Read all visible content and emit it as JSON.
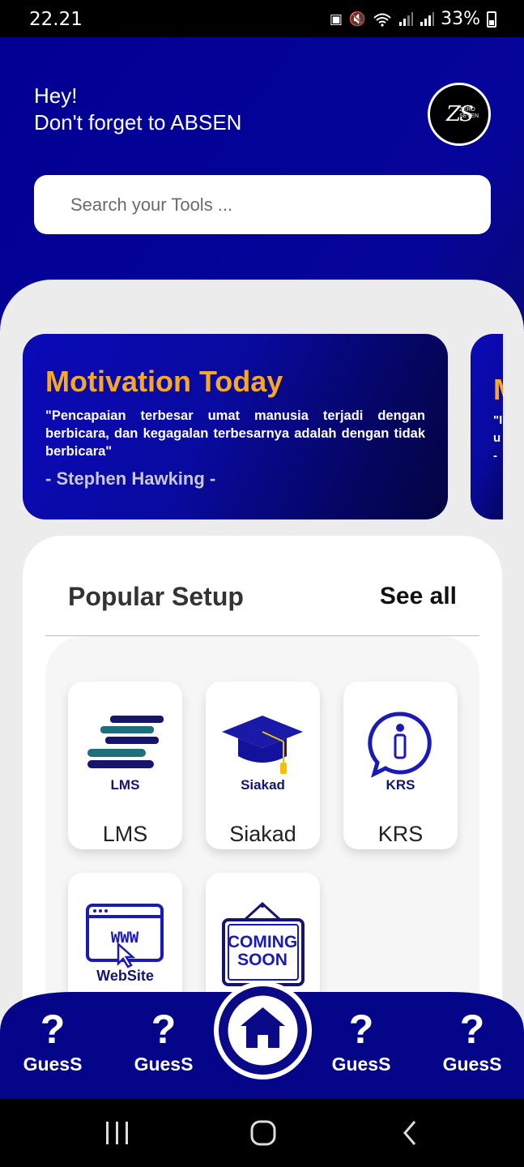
{
  "status_bar": {
    "time": "22.21",
    "battery": "33%",
    "icons": [
      "cast-icon",
      "mute-icon",
      "wifi-icon",
      "signal-icon",
      "signal-icon",
      "battery-icon"
    ]
  },
  "header": {
    "line1": "Hey!",
    "line2": "Don't forget to ABSEN",
    "avatar_text": "ZS",
    "avatar_sub1": "ZERO",
    "avatar_sub2": "SEVEN"
  },
  "search": {
    "placeholder": "Search your Tools ..."
  },
  "motivation": {
    "title": "Motivation Today",
    "quote": "\"Pencapaian terbesar umat manusia terjadi dengan berbicara, dan kegagalan terbesarnya adalah dengan tidak berbicara\"",
    "author": "- Stephen Hawking -",
    "next_peek": {
      "title": "M",
      "text_line1": "\"I",
      "text_line2": "u",
      "author": "-"
    }
  },
  "popular": {
    "title": "Popular Setup",
    "see_all": "See all",
    "tools": [
      {
        "label": "LMS",
        "icon_text": "LMS",
        "icon": "books-icon"
      },
      {
        "label": "Siakad",
        "icon_text": "Siakad",
        "icon": "graduation-cap-icon"
      },
      {
        "label": "KRS",
        "icon_text": "KRS",
        "icon": "info-bubble-icon"
      },
      {
        "label": "",
        "icon_text": "WebSite",
        "icon_browser": "WWW",
        "icon": "website-icon"
      },
      {
        "label": "",
        "icon_text": "COMING",
        "icon_text2": "SOON",
        "icon": "coming-soon-sign-icon"
      }
    ]
  },
  "bottom_nav": {
    "items": [
      {
        "label": "GuesS",
        "icon": "question-mark-icon"
      },
      {
        "label": "GuesS",
        "icon": "question-mark-icon"
      },
      {
        "label": "GuesS",
        "icon": "question-mark-icon"
      },
      {
        "label": "GuesS",
        "icon": "question-mark-icon"
      }
    ],
    "home_icon": "home-icon"
  },
  "colors": {
    "primary": "#06059a",
    "accent": "#f7a823",
    "sheet": "#ececec",
    "nav": "#05058a"
  }
}
